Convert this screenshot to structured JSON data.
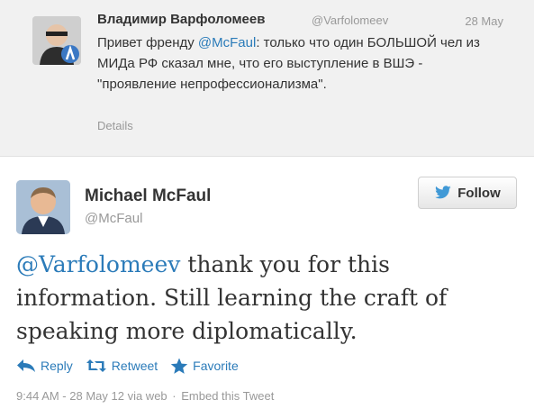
{
  "in_reply_to": {
    "name": "Владимир Варфоломеев",
    "handle": "@Varfolomeev",
    "date": "28 May",
    "text_prefix": "Привет френду ",
    "mention": "@McFaul",
    "text_suffix": ": только что один БОЛЬШОЙ чел из МИДа РФ сказал мне, что его выступление в ВШЭ - \"проявление непрофессионализма\".",
    "details_label": "Details"
  },
  "tweet": {
    "author_name": "Michael McFaul",
    "author_handle": "@McFaul",
    "follow_label": "Follow",
    "mention": "@Varfolomeev",
    "text": " thank you for this information. Still learning the craft of speaking more diplomatically.",
    "actions": {
      "reply": "Reply",
      "retweet": "Retweet",
      "favorite": "Favorite"
    },
    "timestamp": "9:44 AM - 28 May 12",
    "via": "via web",
    "embed_label": "Embed this Tweet"
  },
  "colors": {
    "link": "#2b7bb9",
    "muted": "#999999",
    "text": "#333333",
    "parent_bg": "#f1f1f1"
  }
}
